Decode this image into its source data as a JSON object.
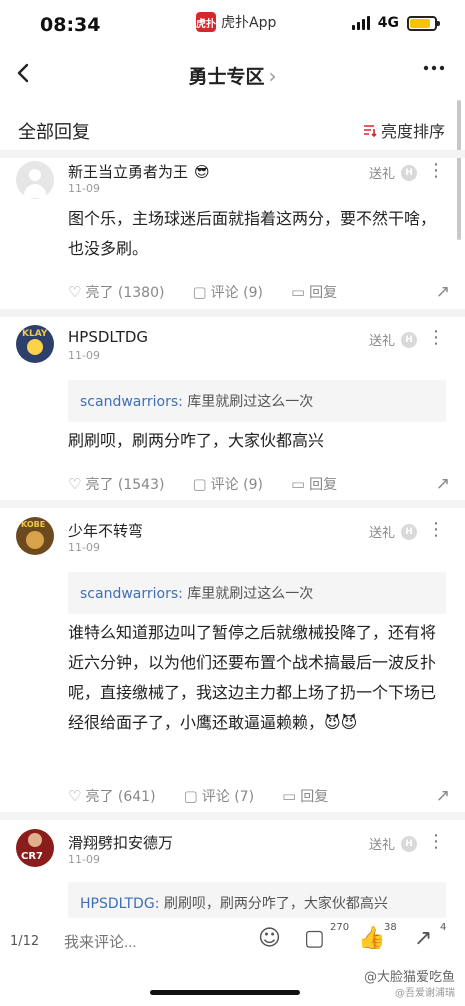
{
  "status_bar": {
    "time": "08:34",
    "app_badge": "虎扑",
    "app_name": "虎扑App",
    "network": "4G",
    "battery_level": 0.85,
    "battery_color": "#f6c400"
  },
  "nav": {
    "back_icon": "chevron-left-icon",
    "title": "勇士专区",
    "title_chevron": "›",
    "more_icon": "more-icon"
  },
  "section": {
    "title": "全部回复",
    "sort_label": "亮度排序",
    "sort_icon": "sort-icon"
  },
  "comments": [
    {
      "username": "新王当立勇者为王",
      "badge_emoji": "😎",
      "date": "11-09",
      "gift_label": "送礼",
      "quote": null,
      "text": "图个乐，主场球迷后面就指着这两分，要不然干啥，也没多刷。",
      "likes": "亮了 (1380)",
      "replies": "评论 (9)",
      "reply_label": "回复"
    },
    {
      "username": "HPSDLTDG",
      "date": "11-09",
      "gift_label": "送礼",
      "quote_author": "scandwarriors:",
      "quote_text": " 库里就刷过这么一次",
      "text": "刷刷呗，刷两分咋了，大家伙都高兴",
      "likes": "亮了 (1543)",
      "replies": "评论 (9)",
      "reply_label": "回复"
    },
    {
      "username": "少年不转弯",
      "date": "11-09",
      "gift_label": "送礼",
      "quote_author": "scandwarriors:",
      "quote_text": " 库里就刷过这么一次",
      "text": "谁特么知道那边叫了暂停之后就缴械投降了，还有将近六分钟，以为他们还要布置个战术搞最后一波反扑呢，直接缴械了，我这边主力都上场了扔一个下场已经很给面子了，小鹰还敢逼逼赖赖，😈😈",
      "likes": "亮了 (641)",
      "replies": "评论 (7)",
      "reply_label": "回复"
    },
    {
      "username": "滑翔劈扣安德万",
      "date": "11-09",
      "gift_label": "送礼",
      "quote_author": "HPSDLTDG:",
      "quote_text": " 刷刷呗，刷两分咋了，大家伙都高兴"
    }
  ],
  "bottom_bar": {
    "page": "1/12",
    "input_placeholder": "我来评论...",
    "comment_count": "270",
    "like_count": "38",
    "share_count": "4"
  },
  "watermark": {
    "line1": "@大脸猫爱吃鱼",
    "line2": "@吾爱谢浦瑞"
  }
}
